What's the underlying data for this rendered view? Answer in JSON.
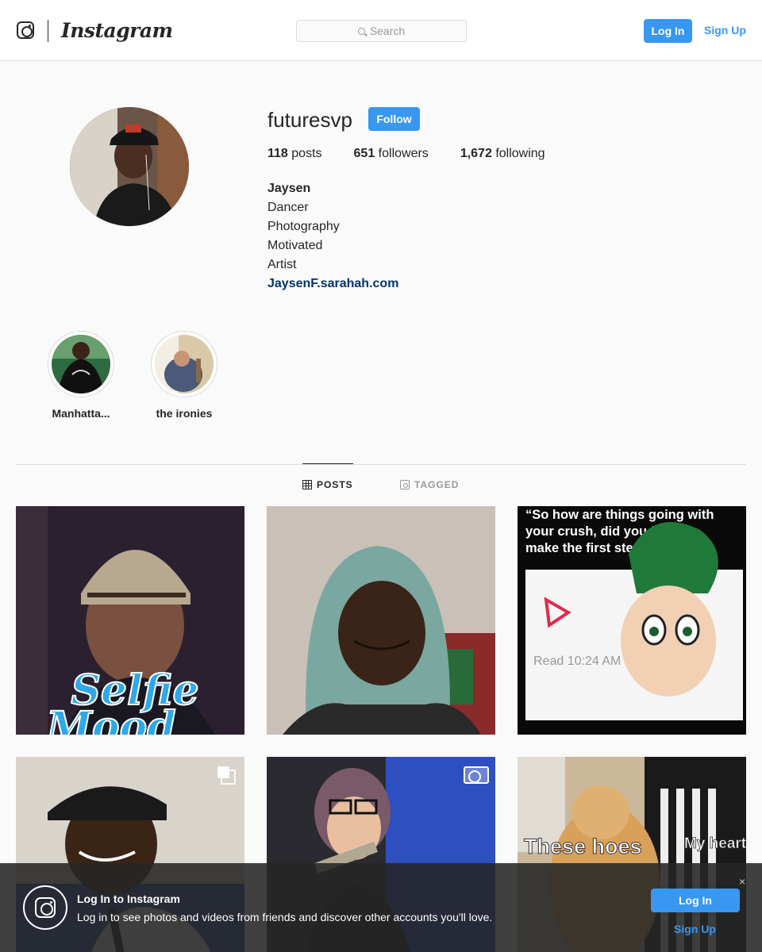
{
  "header": {
    "brand": "Instagram",
    "search_placeholder": "Search",
    "login_label": "Log In",
    "signup_label": "Sign Up"
  },
  "profile": {
    "username": "futuresvp",
    "follow_label": "Follow",
    "stats": {
      "posts_count": "118",
      "posts_label": "posts",
      "followers_count": "651",
      "followers_label": "followers",
      "following_count": "1,672",
      "following_label": "following"
    },
    "bio": {
      "name": "Jaysen",
      "lines": [
        "Dancer",
        "Photography",
        "Motivated",
        "Artist"
      ],
      "link": "JaysenF.sarahah.com"
    }
  },
  "highlights": [
    {
      "label": "Manhatta..."
    },
    {
      "label": "the ironies"
    }
  ],
  "tabs": [
    {
      "label": "POSTS",
      "active": true
    },
    {
      "label": "TAGGED",
      "active": false
    }
  ],
  "posts": [
    {
      "type": "photo",
      "overlay_text": "Selfie Mood"
    },
    {
      "type": "photo"
    },
    {
      "type": "photo",
      "caption_text": "\"So how are things going with your crush, did you finally make the first step?\"",
      "read_text": "Read 10:24 AM"
    },
    {
      "type": "carousel"
    },
    {
      "type": "video"
    },
    {
      "type": "photo",
      "overlay_left": "These hoes",
      "overlay_right": "My heart"
    }
  ],
  "login_banner": {
    "title": "Log In to Instagram",
    "description": "Log in to see photos and videos from friends and discover other accounts you'll love.",
    "login_label": "Log In",
    "signup_label": "Sign Up",
    "close_symbol": "×"
  },
  "colors": {
    "accent": "#3897f0",
    "link": "#003569",
    "background": "#fafafa"
  }
}
